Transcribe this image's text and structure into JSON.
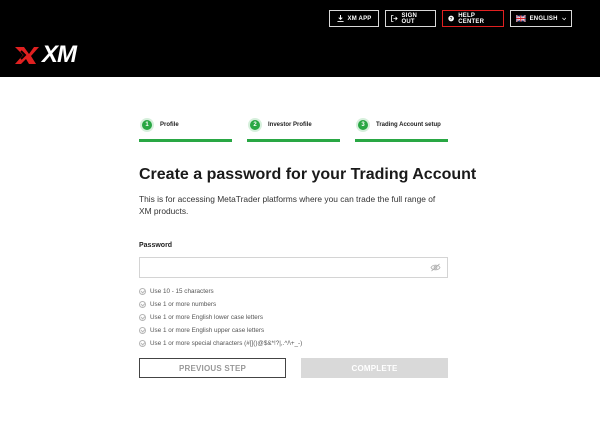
{
  "header": {
    "buttons": {
      "app": "XM APP",
      "signout": "SIGN OUT",
      "help": "HELP CENTER",
      "language": "ENGLISH"
    },
    "logo": "XM",
    "accent_color": "#e02020"
  },
  "steps": [
    {
      "number": "1",
      "label": "Profile"
    },
    {
      "number": "2",
      "label": "Investor Profile"
    },
    {
      "number": "3",
      "label": "Trading Account setup"
    }
  ],
  "step_color": "#29a744",
  "main": {
    "title": "Create a password for your Trading Account",
    "description": "This is for accessing MetaTrader platforms where you can trade the full range of XM products.",
    "password_label": "Password",
    "password_value": "",
    "password_placeholder": ""
  },
  "rules": [
    "Use 10 - 15 characters",
    "Use 1 or more numbers",
    "Use 1 or more English lower case letters",
    "Use 1 or more English upper case letters",
    "Use 1 or more special characters (#[]()@$&*!?|,.^/\\+_-)"
  ],
  "actions": {
    "previous": "PREVIOUS STEP",
    "complete": "COMPLETE"
  }
}
